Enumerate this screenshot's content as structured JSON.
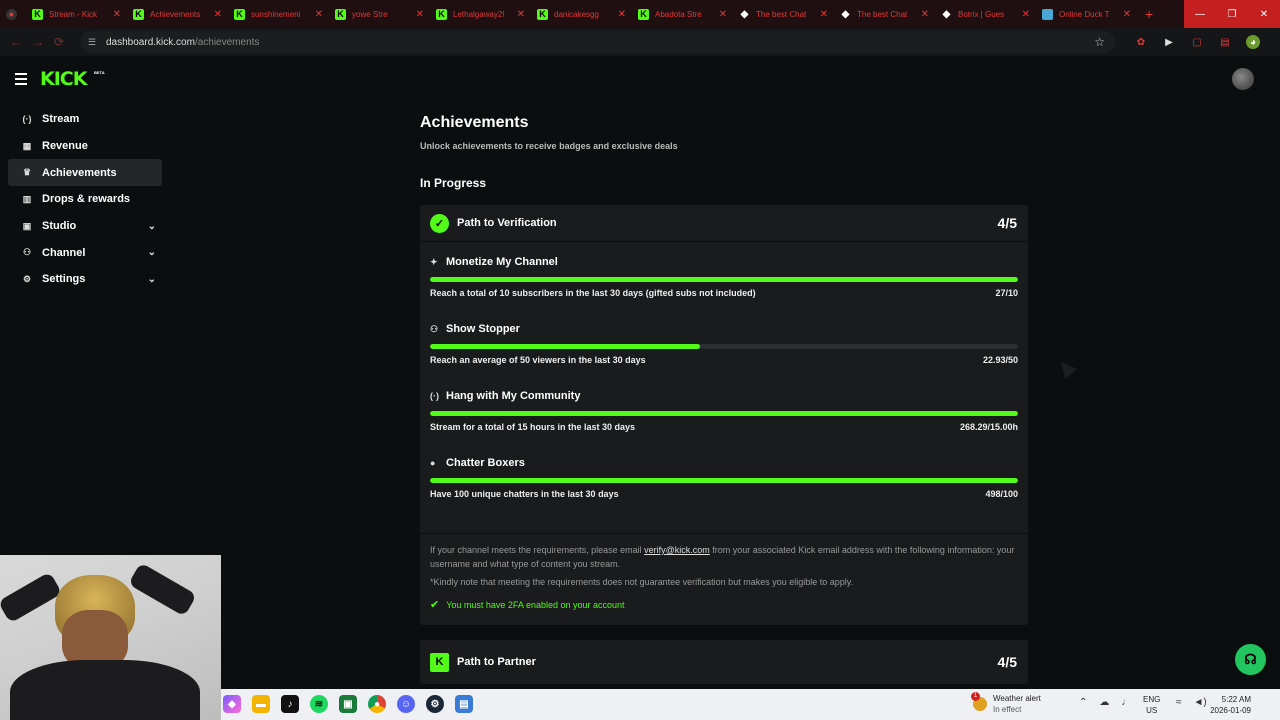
{
  "browser": {
    "tabs": [
      {
        "label": "Stream - Kick",
        "favicon": "kick"
      },
      {
        "label": "Achievements",
        "favicon": "kick"
      },
      {
        "label": "sunshinemeni",
        "favicon": "kick"
      },
      {
        "label": "yowe Stre",
        "favicon": "kick"
      },
      {
        "label": "Lethalgaway2l",
        "favicon": "kick"
      },
      {
        "label": "danicakesgg",
        "favicon": "kick"
      },
      {
        "label": "Abadota Stre",
        "favicon": "kick"
      },
      {
        "label": "The best Chat",
        "favicon": "diamond"
      },
      {
        "label": "The best Chat",
        "favicon": "diamond"
      },
      {
        "label": "Botrix | Gues",
        "favicon": "diamond"
      },
      {
        "label": "Online Duck T",
        "favicon": "duck"
      }
    ],
    "url_host": "dashboard.kick.com",
    "url_path": "/achievements"
  },
  "header": {
    "logo": "KICK",
    "beta": "BETA"
  },
  "sidebar": {
    "items": [
      {
        "label": "Stream",
        "icon": "broadcast-icon",
        "glyph": "(·)"
      },
      {
        "label": "Revenue",
        "icon": "chart-icon",
        "glyph": "▦"
      },
      {
        "label": "Achievements",
        "icon": "trophy-icon",
        "glyph": "🏆"
      },
      {
        "label": "Drops & rewards",
        "icon": "gift-icon",
        "glyph": "▥"
      },
      {
        "label": "Studio",
        "icon": "studio-icon",
        "glyph": "▣"
      },
      {
        "label": "Channel",
        "icon": "users-icon",
        "glyph": "⚇"
      },
      {
        "label": "Settings",
        "icon": "gear-icon",
        "glyph": "⚙"
      }
    ]
  },
  "page": {
    "title": "Achievements",
    "subtitle": "Unlock achievements to receive badges and exclusive deals",
    "section": "In Progress"
  },
  "verification": {
    "title": "Path to Verification",
    "score": "4/5",
    "tasks": [
      {
        "title": "Monetize My Channel",
        "icon": "sparkle-icon",
        "glyph": "✦",
        "desc": "Reach a total of 10 subscribers in the last 30 days (gifted subs not included)",
        "value": "27/10",
        "progress": 1.0
      },
      {
        "title": "Show Stopper",
        "icon": "people-icon",
        "glyph": "⚇",
        "desc": "Reach an average of 50 viewers in the last 30 days",
        "value": "22.93/50",
        "progress": 0.4586
      },
      {
        "title": "Hang with My Community",
        "icon": "broadcast-icon",
        "glyph": "(·)",
        "desc": "Stream for a total of 15 hours in the last 30 days",
        "value": "268.29/15.00h",
        "progress": 1.0
      },
      {
        "title": "Chatter Boxers",
        "icon": "chat-icon",
        "glyph": "●",
        "desc": "Have 100 unique chatters in the last 30 days",
        "value": "498/100",
        "progress": 1.0
      }
    ],
    "note_before": "If your channel meets the requirements, please email ",
    "note_email": "verify@kick.com",
    "note_after": " from your associated Kick email address with the following information: your username and what type of content you stream.",
    "note2": "*Kindly note that meeting the requirements does not guarantee verification but makes you eligible to apply.",
    "twofa": "You must have 2FA enabled on your account"
  },
  "partner": {
    "title": "Path to Partner",
    "score": "4/5"
  },
  "taskbar": {
    "weather_title": "Weather alert",
    "weather_status": "In effect",
    "weather_badge": "1",
    "lang1": "ENG",
    "lang2": "US",
    "time": "5:22 AM",
    "date": "2026-01-09"
  },
  "colors": {
    "accent": "#53fc18",
    "background": "#0b0e0f",
    "card": "#191b1d"
  }
}
